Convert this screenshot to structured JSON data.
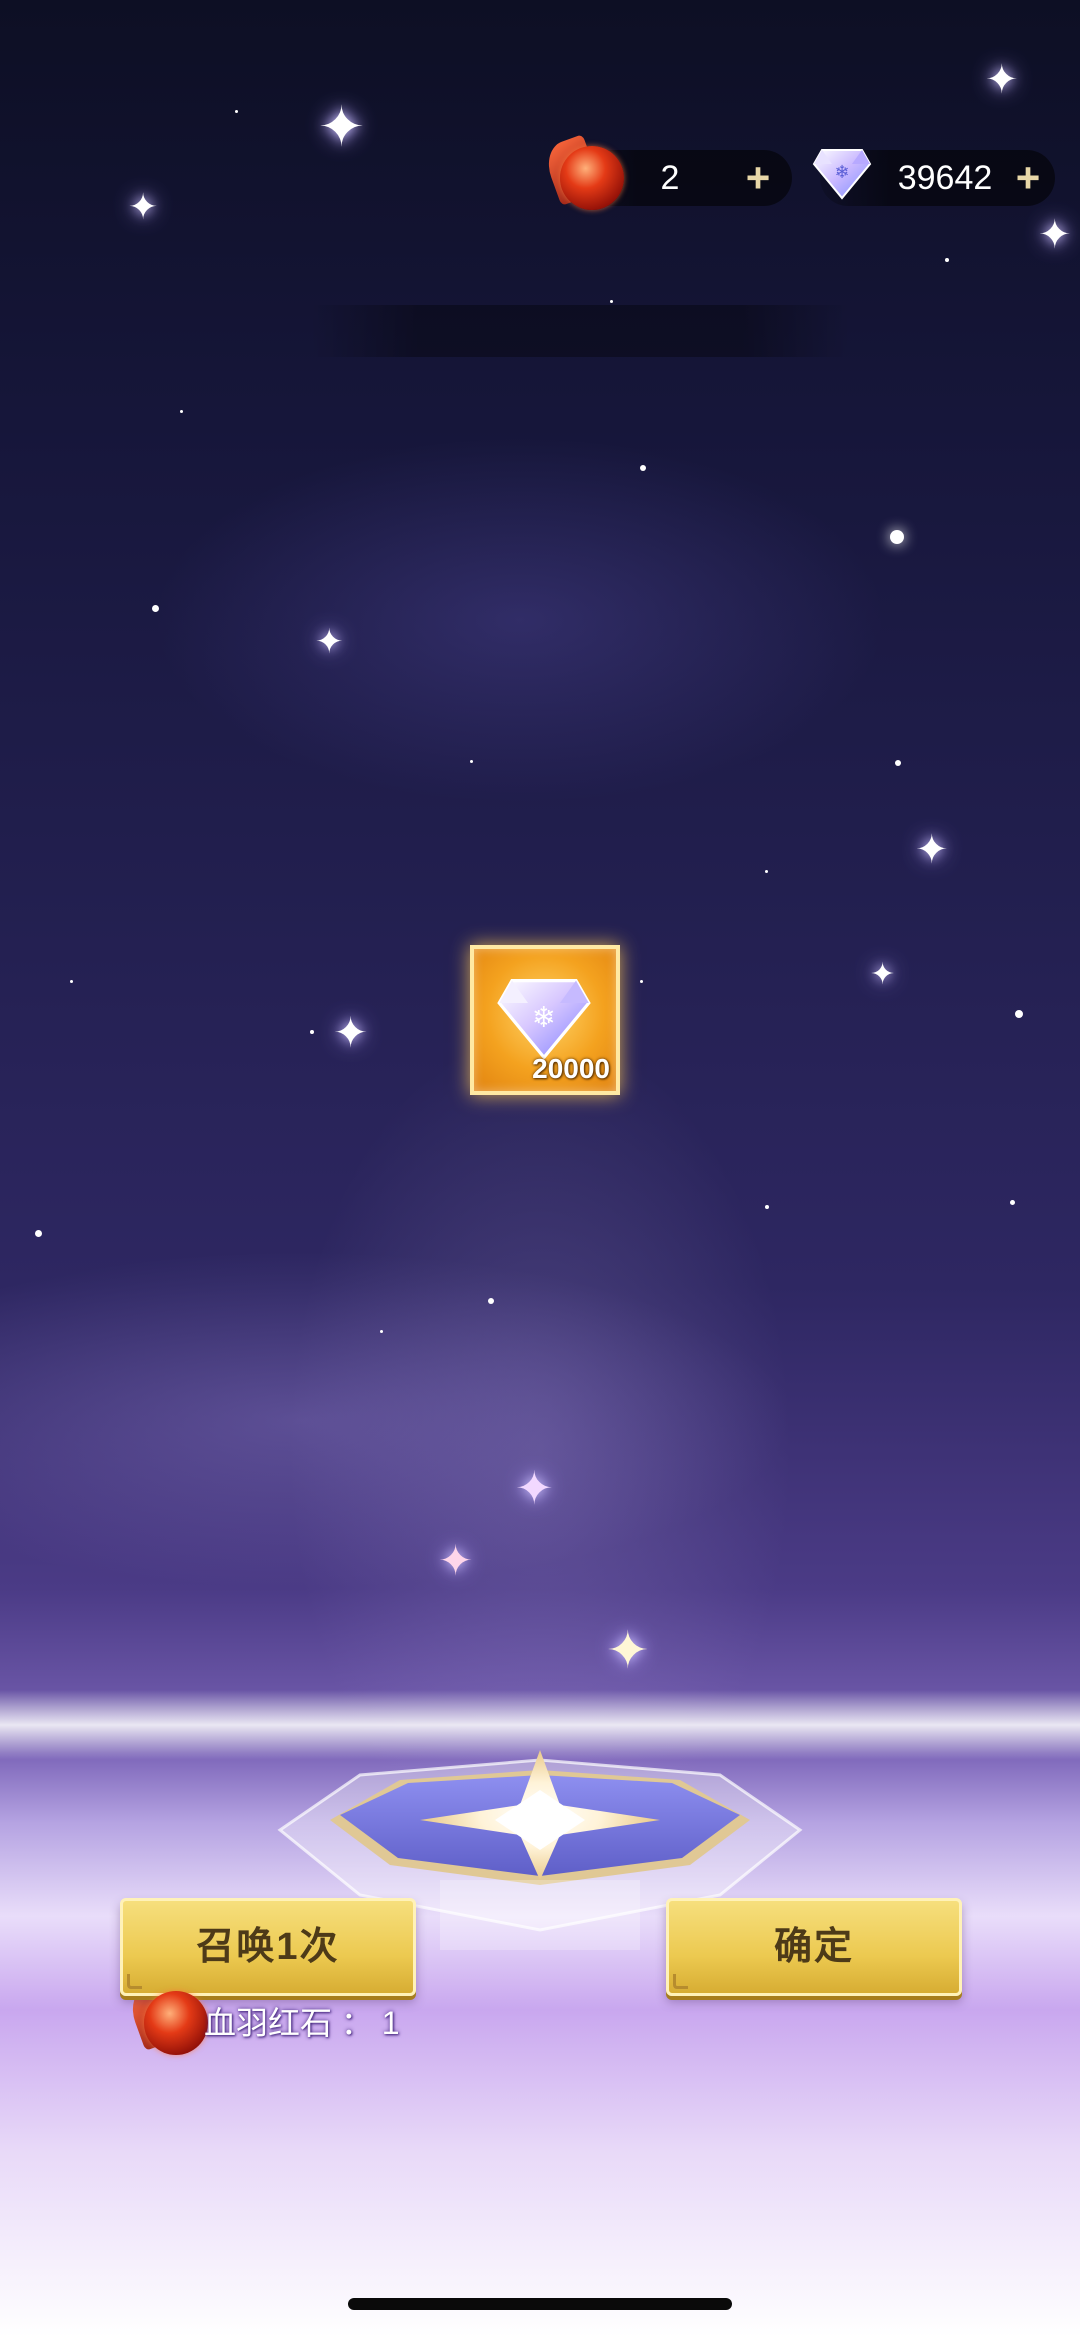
{
  "currencies": {
    "blood_stone": {
      "icon": "blood-feather-red-stone-icon",
      "value": "2",
      "plus": "+"
    },
    "diamond": {
      "icon": "diamond-icon",
      "value": "39642",
      "plus": "+"
    }
  },
  "reward": {
    "icon": "diamond-icon",
    "amount": "20000"
  },
  "buttons": {
    "summon_once": "召唤1次",
    "confirm": "确定"
  },
  "cost": {
    "icon": "blood-feather-red-stone-icon",
    "text": "血羽红石 ： 1"
  },
  "colors": {
    "button_gold": "#ecc950",
    "button_text": "#4d3a18",
    "reward_orange": "#f4a21f",
    "sky_dark": "#0d0f24",
    "sky_purple": "#4b3b86"
  }
}
